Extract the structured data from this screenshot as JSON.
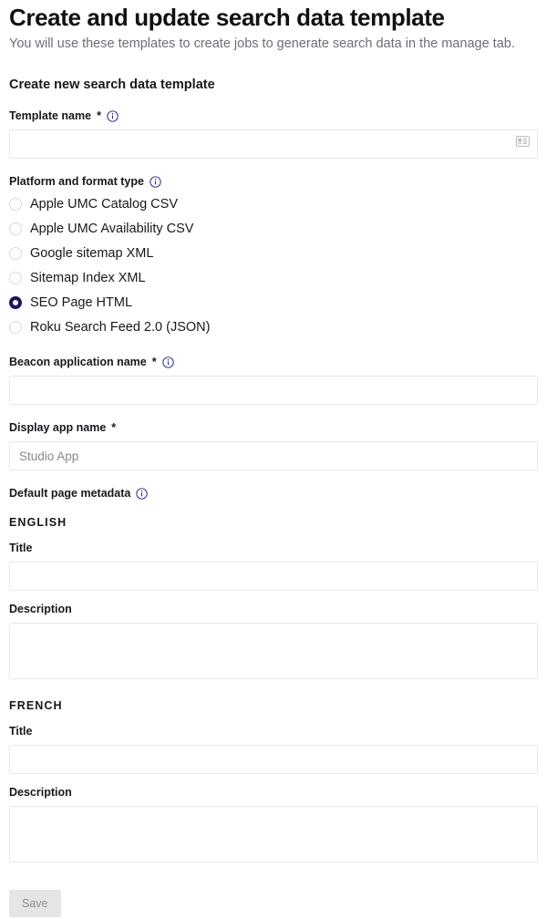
{
  "header": {
    "title": "Create and update search data template",
    "subtitle": "You will use these templates to create jobs to generate search data in the manage tab."
  },
  "form": {
    "section_heading": "Create new search data template",
    "template_name": {
      "label": "Template name",
      "required_marker": "*",
      "info_icon": "info-circle-icon",
      "value": "",
      "placeholder": "",
      "trailing_icon": "address-card-icon"
    },
    "platform_format": {
      "label": "Platform and format type",
      "info_icon": "info-circle-icon",
      "selected": "SEO Page HTML",
      "options": [
        {
          "label": "Apple UMC Catalog CSV",
          "checked": false
        },
        {
          "label": "Apple UMC Availability CSV",
          "checked": false
        },
        {
          "label": "Google sitemap XML",
          "checked": false
        },
        {
          "label": "Sitemap Index XML",
          "checked": false
        },
        {
          "label": "SEO Page HTML",
          "checked": true
        },
        {
          "label": "Roku Search Feed 2.0 (JSON)",
          "checked": false
        }
      ]
    },
    "beacon_application_name": {
      "label": "Beacon application name",
      "required_marker": "*",
      "info_icon": "info-circle-icon",
      "value": "",
      "placeholder": ""
    },
    "display_app_name": {
      "label": "Display app name",
      "required_marker": "*",
      "value": "",
      "placeholder": "Studio App"
    },
    "default_page_metadata": {
      "label": "Default page metadata",
      "info_icon": "info-circle-icon",
      "languages": [
        {
          "name": "ENGLISH",
          "title_label": "Title",
          "title_value": "",
          "description_label": "Description",
          "description_value": ""
        },
        {
          "name": "FRENCH",
          "title_label": "Title",
          "title_value": "",
          "description_label": "Description",
          "description_value": ""
        }
      ]
    },
    "save_button": {
      "label": "Save",
      "disabled": true
    }
  },
  "colors": {
    "accent": "#1b1464",
    "heading": "#101114",
    "subtitle": "#6b6f76",
    "border": "#e6e7e9",
    "disabled_bg": "#e4e5e6",
    "disabled_text": "#8b8e93"
  }
}
